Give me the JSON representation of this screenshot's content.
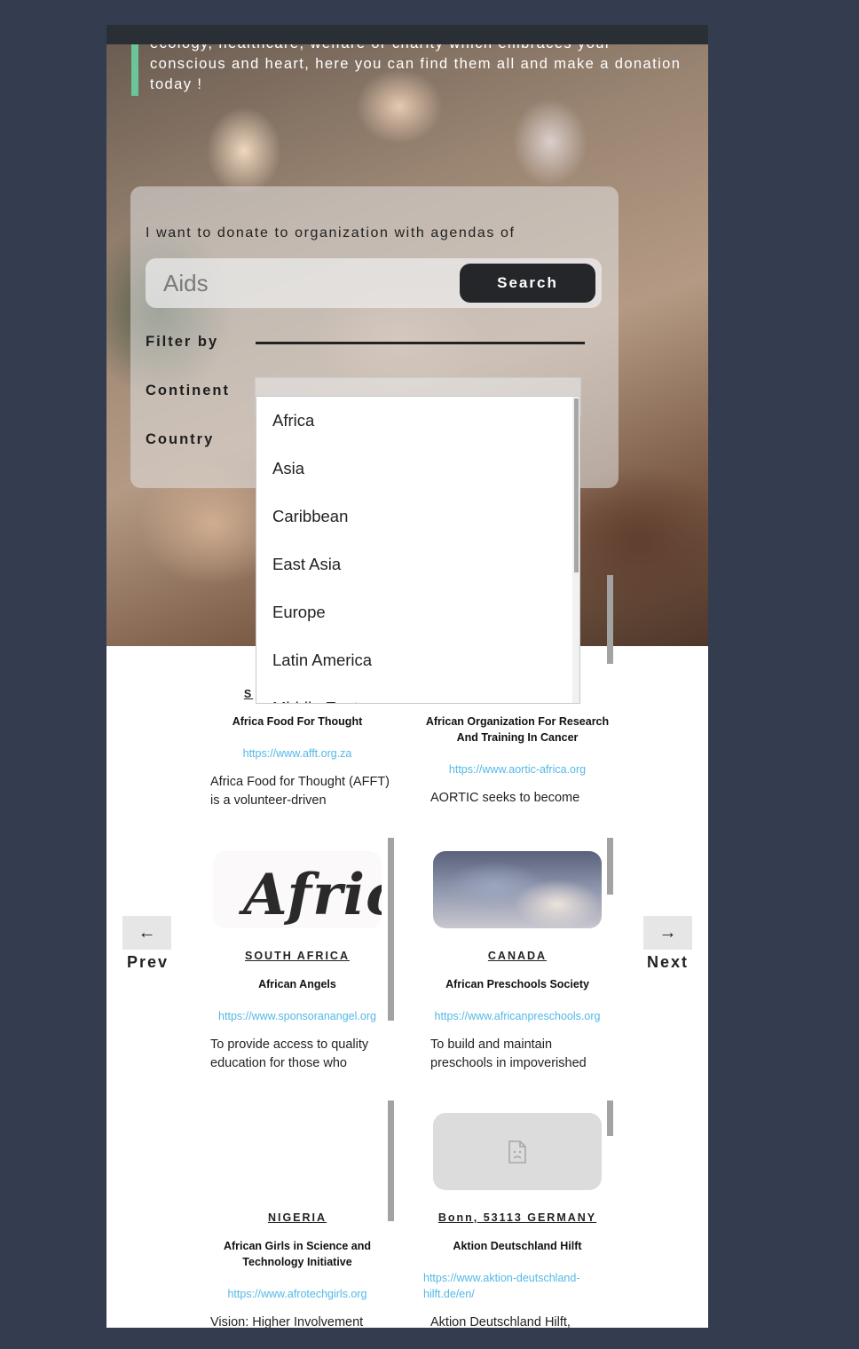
{
  "hero": {
    "text": "ecology, healthcare, welfare or charity which embraces your conscious and heart, here you can find them all and make a donation today !"
  },
  "search": {
    "prompt": "I want to donate to organization with agendas of",
    "placeholder": "Aids",
    "button_label": "Search"
  },
  "filters": {
    "filter_by_label": "Filter by",
    "continent_label": "Continent",
    "country_label": "Country"
  },
  "continent_options": [
    "Africa",
    "Asia",
    "Caribbean",
    "East Asia",
    "Europe",
    "Latin America",
    "Middle East"
  ],
  "cards": [
    {
      "country": "S",
      "org": "Africa Food For Thought",
      "url": "https://www.afft.org.za",
      "desc": "Africa Food for Thought (AFFT) is a volunteer-driven"
    },
    {
      "country": "",
      "org": "African Organization For Research And Training In Cancer",
      "url": "https://www.aortic-africa.org",
      "desc": "AORTIC seeks to become"
    },
    {
      "country": "SOUTH AFRICA",
      "org": "African Angels",
      "url": "https://www.sponsoranangel.org",
      "desc": "To provide access to quality education for those who",
      "logo_text": "Afric"
    },
    {
      "country": "CANADA",
      "org": "African Preschools Society",
      "url": "https://www.africanpreschools.org",
      "desc": "To build and maintain preschools in impoverished"
    },
    {
      "country": "NIGERIA",
      "org": "African Girls in Science and Technology Initiative",
      "url": "https://www.afrotechgirls.org",
      "desc": "Vision: Higher Involvement"
    },
    {
      "country": "Bonn, 53113 GERMANY",
      "org": "Aktion Deutschland Hilft",
      "url": "https://www.aktion-deutschland-hilft.de/en/",
      "desc": "Aktion Deutschland Hilft,"
    }
  ],
  "pagination": {
    "prev_arrow": "←",
    "prev_label": "Prev",
    "next_arrow": "→",
    "next_label": "Next"
  }
}
